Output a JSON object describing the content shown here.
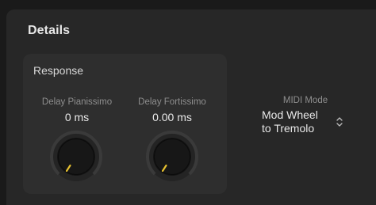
{
  "panel": {
    "title": "Details"
  },
  "response": {
    "title": "Response",
    "knobs": [
      {
        "label": "Delay Pianissimo",
        "value": "0 ms",
        "level": 0.0
      },
      {
        "label": "Delay Fortissimo",
        "value": "0.00 ms",
        "level": 0.0
      }
    ]
  },
  "midi_mode": {
    "label": "MIDI Mode",
    "value_line1": "Mod Wheel",
    "value_line2": "to Tremolo"
  },
  "colors": {
    "background": "#1a1a1a",
    "panel": "#272727",
    "section": "#2e2e2e",
    "knob_pointer": "#e8c230",
    "label_gray": "#8e8e8e",
    "value_white": "#e8e8e8"
  },
  "icons": {
    "select_indicator": "chevron-up-down-icon"
  }
}
